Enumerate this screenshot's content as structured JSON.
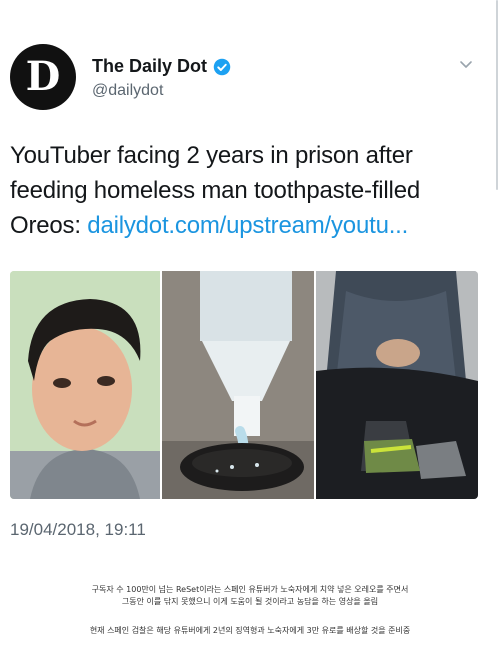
{
  "tweet": {
    "author": {
      "name": "The Daily Dot",
      "handle": "@dailydot",
      "avatar_letter": "D",
      "verified": true,
      "verified_icon": "verified-badge-icon"
    },
    "menu_icon": "chevron-down-icon",
    "text_lines": [
      "YouTuber facing 2 years in prison after",
      "feeding homeless man toothpaste-filled",
      "Oreos: "
    ],
    "link_text": "dailydot.com/upstream/youtu...",
    "media": [
      {
        "name": "youtuber-face-photo"
      },
      {
        "name": "toothpaste-oreo-photo"
      },
      {
        "name": "homeless-man-photo"
      }
    ],
    "timestamp": "19/04/2018, 19:11"
  },
  "caption": {
    "line1": "구독자 수 100만이 넘는 ReSet이라는 스페인 유튜버가 노숙자에게 치약 넣은 오레오를 주면서",
    "line2": "그동안 이를 닦지 못했으니 이게 도움이 될 것이라고 농담을 하는 영상을 올림",
    "line3": "현재 스페인 검찰은 해당 유튜버에게 2년의 징역형과 노숙자에게 3만 유로를 배상할 것을 준비중"
  },
  "colors": {
    "link": "#1b95e0",
    "text": "#14171a",
    "secondary": "#5b6670",
    "verified": "#1da1f2"
  }
}
